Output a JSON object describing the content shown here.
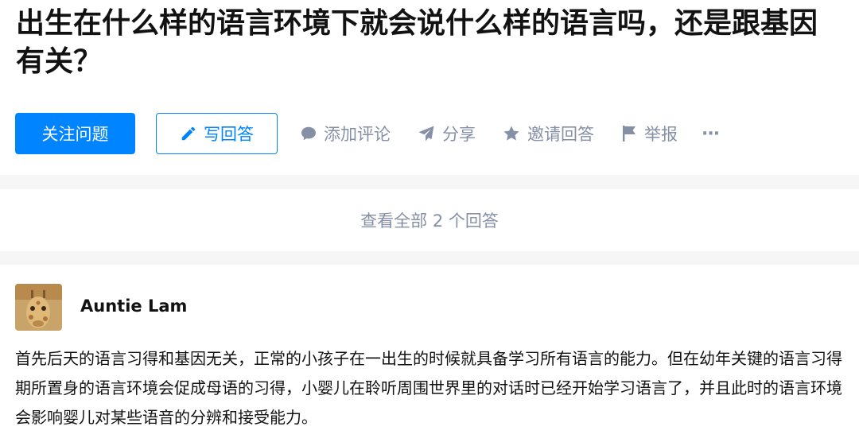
{
  "question": {
    "title": "出生在什么样的语言环境下就会说什么样的语言吗，还是跟基因有关？"
  },
  "actions": {
    "follow_label": "关注问题",
    "write_label": "写回答",
    "comment_label": "添加评论",
    "share_label": "分享",
    "invite_label": "邀请回答",
    "report_label": "举报",
    "more_label": "···"
  },
  "view_all": {
    "label": "查看全部 2 个回答"
  },
  "answer": {
    "author": "Auntie Lam",
    "content": "首先后天的语言习得和基因无关，正常的小孩子在一出生的时候就具备学习所有语言的能力。但在幼年关键的语言习得期所置身的语言环境会促成母语的习得，小婴儿在聆听周围世界里的对话时已经开始学习语言了，并且此时的语言环境会影响婴儿对某些语音的分辨和接受能力。"
  },
  "colors": {
    "accent": "#0084ff",
    "meta_gray": "#8590a6",
    "text": "#121212",
    "background": "#f6f6f6"
  },
  "icons": {
    "write": "pencil-icon",
    "comment": "speech-bubble-icon",
    "share": "paper-plane-icon",
    "invite": "star-icon",
    "report": "flag-icon",
    "more": "ellipsis-icon",
    "avatar": "giraffe-avatar"
  }
}
